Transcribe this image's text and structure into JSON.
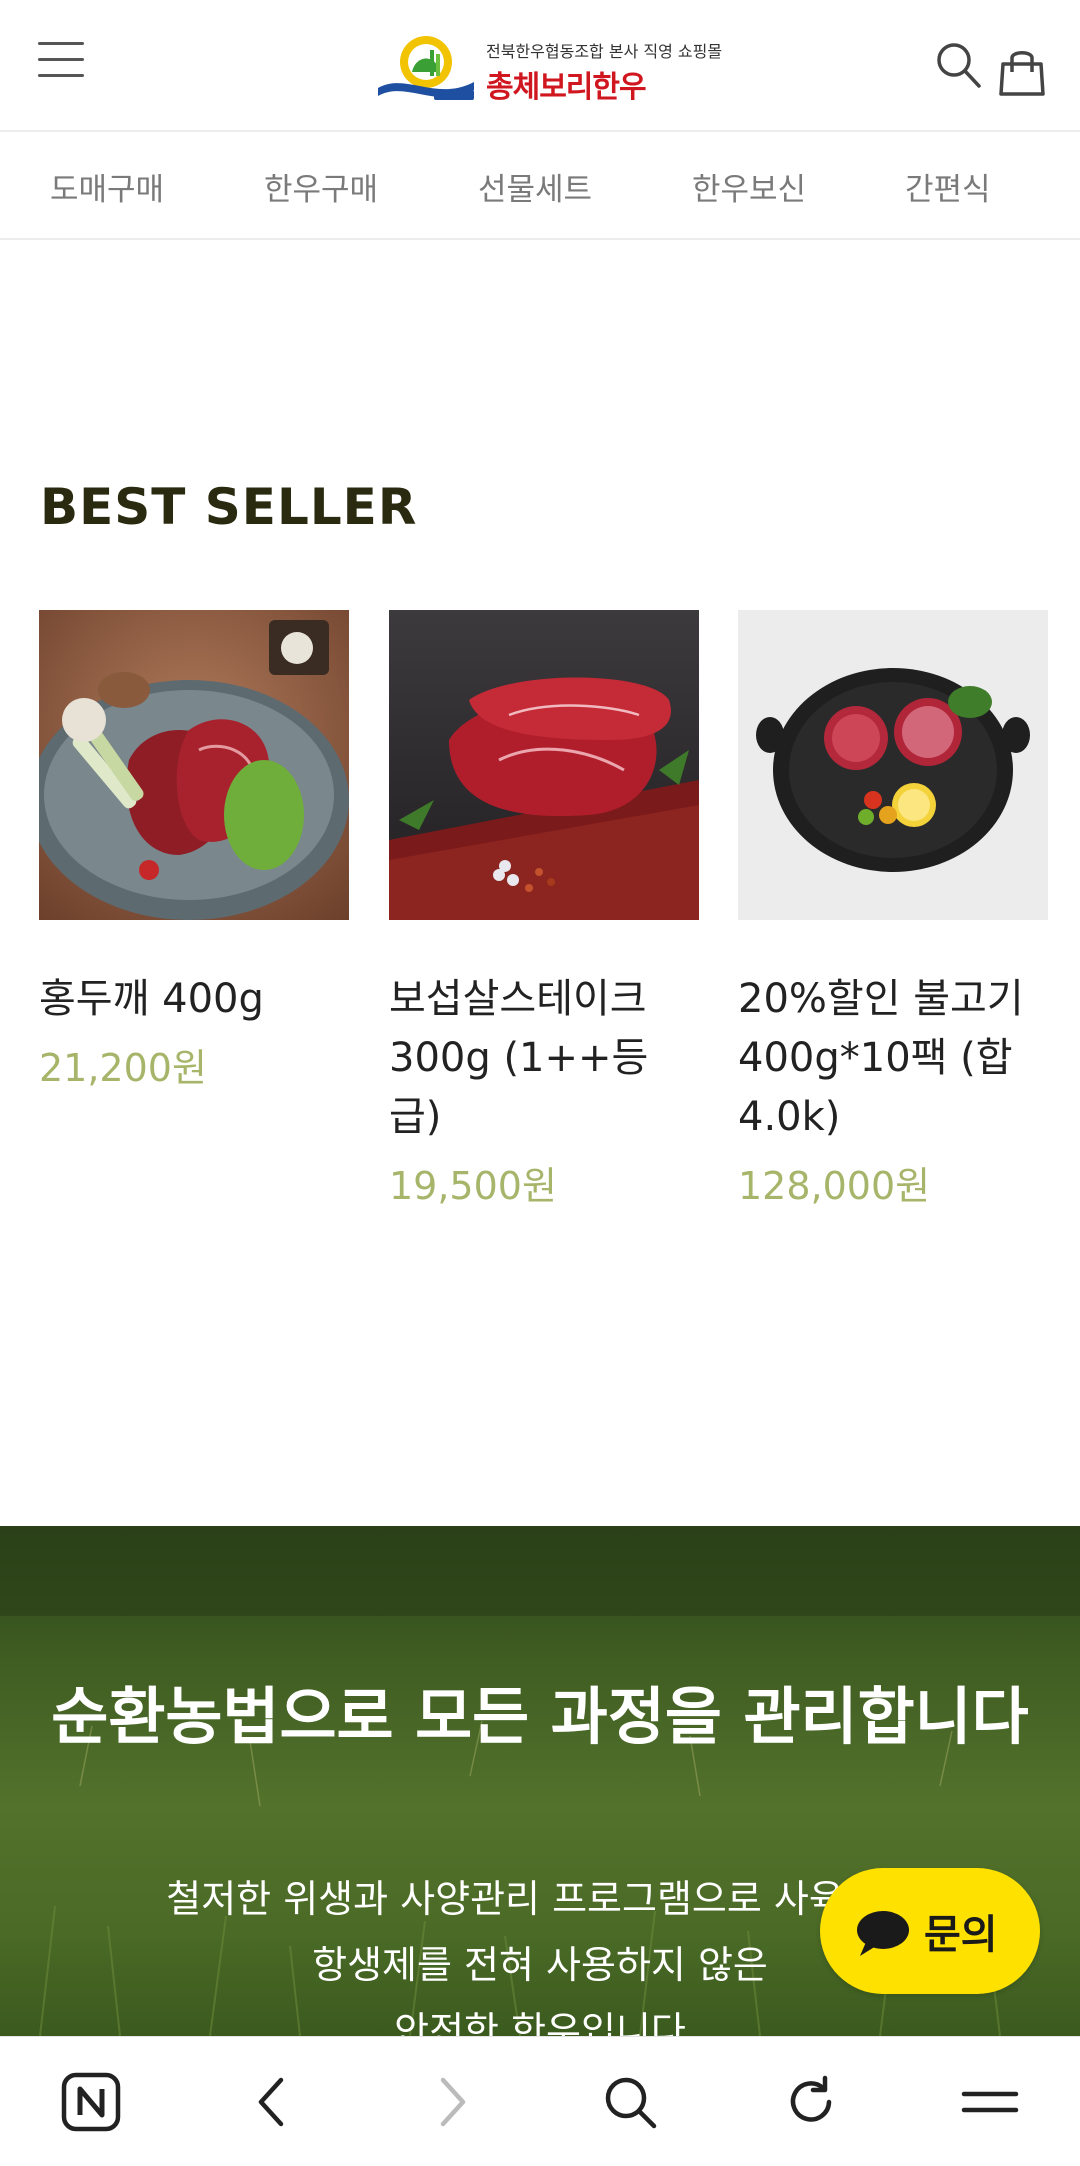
{
  "header": {
    "menu_icon": "hamburger-icon",
    "logo_tagline": "전북한우협동조합 본사 직영 쇼핑몰",
    "logo_name": "총체보리한우",
    "search_icon": "search-icon",
    "cart_icon": "shopping-bag-icon"
  },
  "categories": [
    "도매구매",
    "한우구매",
    "선물세트",
    "한우보신",
    "간편식"
  ],
  "best_seller": {
    "title": "BEST SELLER",
    "products": [
      {
        "name": "홍두깨 400g",
        "price": "21,200원"
      },
      {
        "name": "보섭살스테이크 300g (1++등급)",
        "price": "19,500원"
      },
      {
        "name": "20%할인 불고기 400g*10팩 (합4.0k)",
        "price": "128,000원"
      }
    ]
  },
  "banner": {
    "title": "순환농법으로 모든 과정을 관리합니다",
    "desc_line1": "철저한 위생과 사양관리 프로그램으로 사육하여",
    "desc_line2": "항생제를 전혀 사용하지 않은",
    "desc_line3": "안전한 한우입니다"
  },
  "chat": {
    "label": "문의",
    "icon": "speech-bubble-icon"
  },
  "browser_bar": {
    "icons": [
      "naver-home-icon",
      "back-icon",
      "forward-icon",
      "search-icon",
      "refresh-icon",
      "menu-icon"
    ]
  },
  "colors": {
    "price": "#a6b56a",
    "brand_red": "#d0161f",
    "chat_yellow": "#ffe100",
    "title_dark": "#2a2a10"
  }
}
